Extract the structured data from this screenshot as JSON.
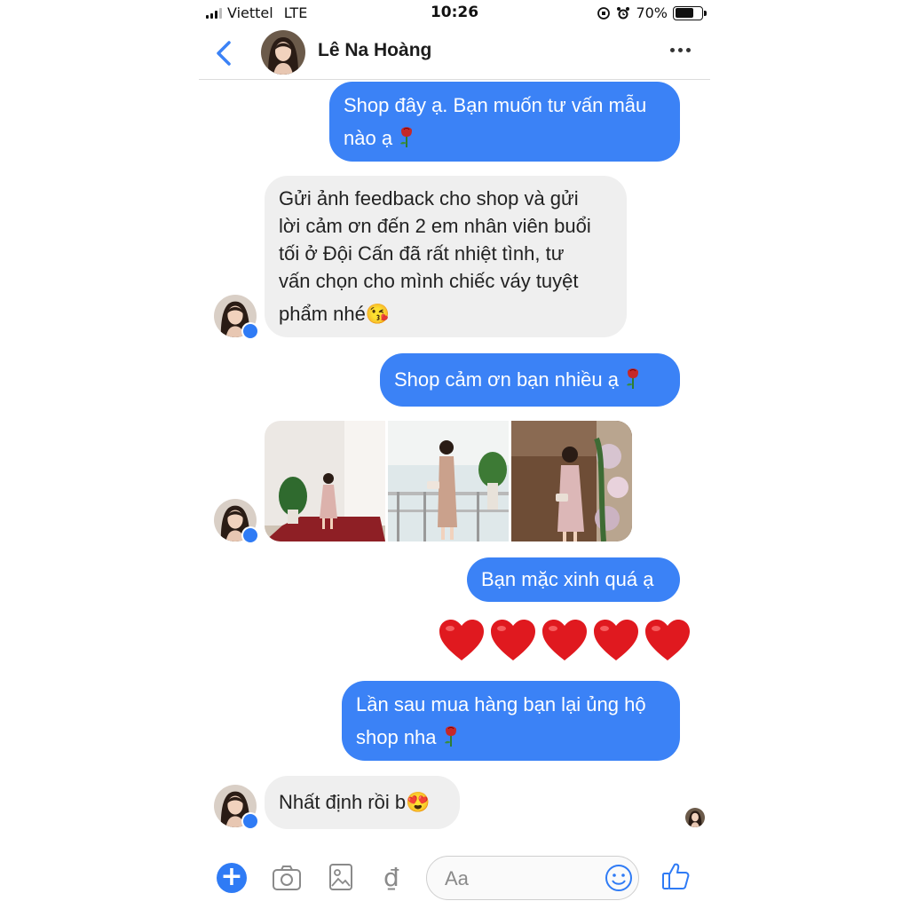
{
  "status_bar": {
    "carrier": "Viettel",
    "network": "LTE",
    "time": "10:26",
    "battery": "70%",
    "battery_level": 0.7
  },
  "header": {
    "contact_name": "Lê Na Hoàng"
  },
  "messages": [
    {
      "from": "shop",
      "text_line1": "Shop đây ạ. Bạn muốn tư vấn mẫu",
      "text_line2": "nào ạ",
      "emoji": "rose-icon"
    },
    {
      "from": "customer",
      "lines": [
        "Gửi ảnh feedback cho shop và gửi",
        "lời cảm ơn đến 2 em nhân viên buổi",
        "tối ở Đội Cấn đã rất nhiệt tình, tư",
        "vấn chọn cho mình chiếc váy tuyệt",
        "phẩm nhé😘"
      ]
    },
    {
      "from": "shop",
      "text": "Shop cảm ơn bạn nhiều ạ",
      "emoji": "rose-icon"
    },
    {
      "from": "customer",
      "type": "photos",
      "count": 3
    },
    {
      "from": "shop",
      "text": "Bạn mặc xinh quá ạ"
    },
    {
      "from": "shop",
      "type": "hearts",
      "text": "❤️❤️❤️❤️❤️",
      "count": 5
    },
    {
      "from": "shop",
      "text_line1": "Lần sau mua hàng bạn lại ủng hộ",
      "text_line2": "shop nha",
      "emoji": "rose-icon"
    },
    {
      "from": "customer",
      "text": "Nhất định rồi b😍"
    }
  ],
  "composer": {
    "placeholder": "Aa",
    "currency_symbol": "₫"
  },
  "colors": {
    "outgoing_bubble": "#3b82f6",
    "incoming_bubble": "#efefef",
    "accent": "#2f7bf5",
    "heart": "#e0191f"
  }
}
